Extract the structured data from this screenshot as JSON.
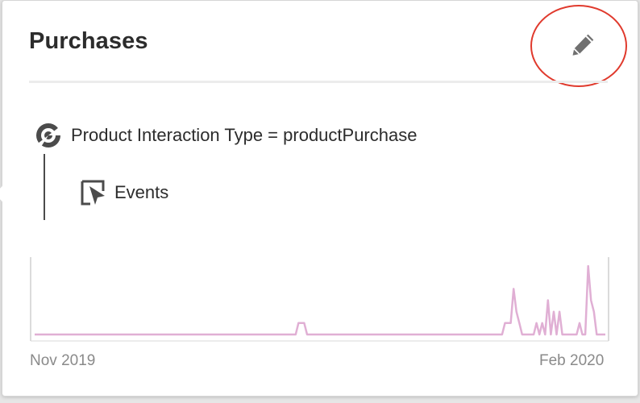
{
  "card": {
    "title": "Purchases"
  },
  "edit_button": {
    "icon": "pencil-icon"
  },
  "rule": {
    "icon": "segment-icon",
    "text": "Product Interaction Type = productPurchase"
  },
  "metric": {
    "icon": "events-icon",
    "label": "Events"
  },
  "colors": {
    "accent_line": "#e0afd4",
    "callout": "#e03a2d"
  },
  "chart_data": {
    "type": "line",
    "xlabel": "",
    "ylabel": "",
    "x_tick_labels": [
      "Nov 2019",
      "Feb 2020"
    ],
    "grid": false,
    "series": [
      {
        "values": [
          0,
          0,
          0,
          0,
          0,
          0,
          0,
          0,
          0,
          0,
          0,
          0,
          0,
          0,
          0,
          0,
          0,
          0,
          0,
          0,
          0,
          0,
          0,
          0,
          0,
          0,
          0,
          0,
          0,
          0,
          0,
          0,
          0,
          0,
          0,
          0,
          0,
          0,
          0,
          0,
          0,
          0,
          0,
          0,
          0,
          0,
          0,
          0,
          0,
          0,
          0,
          0,
          0,
          0,
          0,
          0,
          0,
          0,
          0,
          0,
          0,
          0,
          0,
          0,
          0,
          0,
          0,
          0,
          0,
          0,
          0,
          0,
          0,
          0,
          0,
          0,
          0,
          0,
          0,
          0,
          0,
          0,
          0,
          0,
          0,
          0,
          0,
          0,
          0,
          0,
          0,
          0,
          1,
          1,
          1,
          0,
          0,
          0,
          0,
          0,
          0,
          0,
          0,
          0,
          0,
          0,
          0,
          0,
          0,
          0,
          0,
          0,
          0,
          0,
          0,
          0,
          0,
          0,
          0,
          0,
          0,
          0,
          0,
          0,
          0,
          0,
          0,
          0,
          0,
          0,
          0,
          0,
          0,
          0,
          0,
          0,
          0,
          0,
          0,
          0,
          0,
          0,
          0,
          0,
          0,
          0,
          0,
          0,
          0,
          0,
          0,
          0,
          0,
          0,
          0,
          0,
          0,
          0,
          0,
          0,
          0,
          0,
          0,
          0,
          1,
          1,
          1,
          4,
          2,
          1,
          0,
          0,
          0,
          0,
          0,
          1,
          0,
          1,
          0,
          3,
          0,
          2,
          0,
          2,
          0,
          0,
          0,
          0,
          0,
          0,
          1,
          0,
          0,
          6,
          3,
          2,
          0,
          0,
          0,
          0
        ]
      }
    ],
    "ylim": [
      0,
      6.5
    ]
  }
}
